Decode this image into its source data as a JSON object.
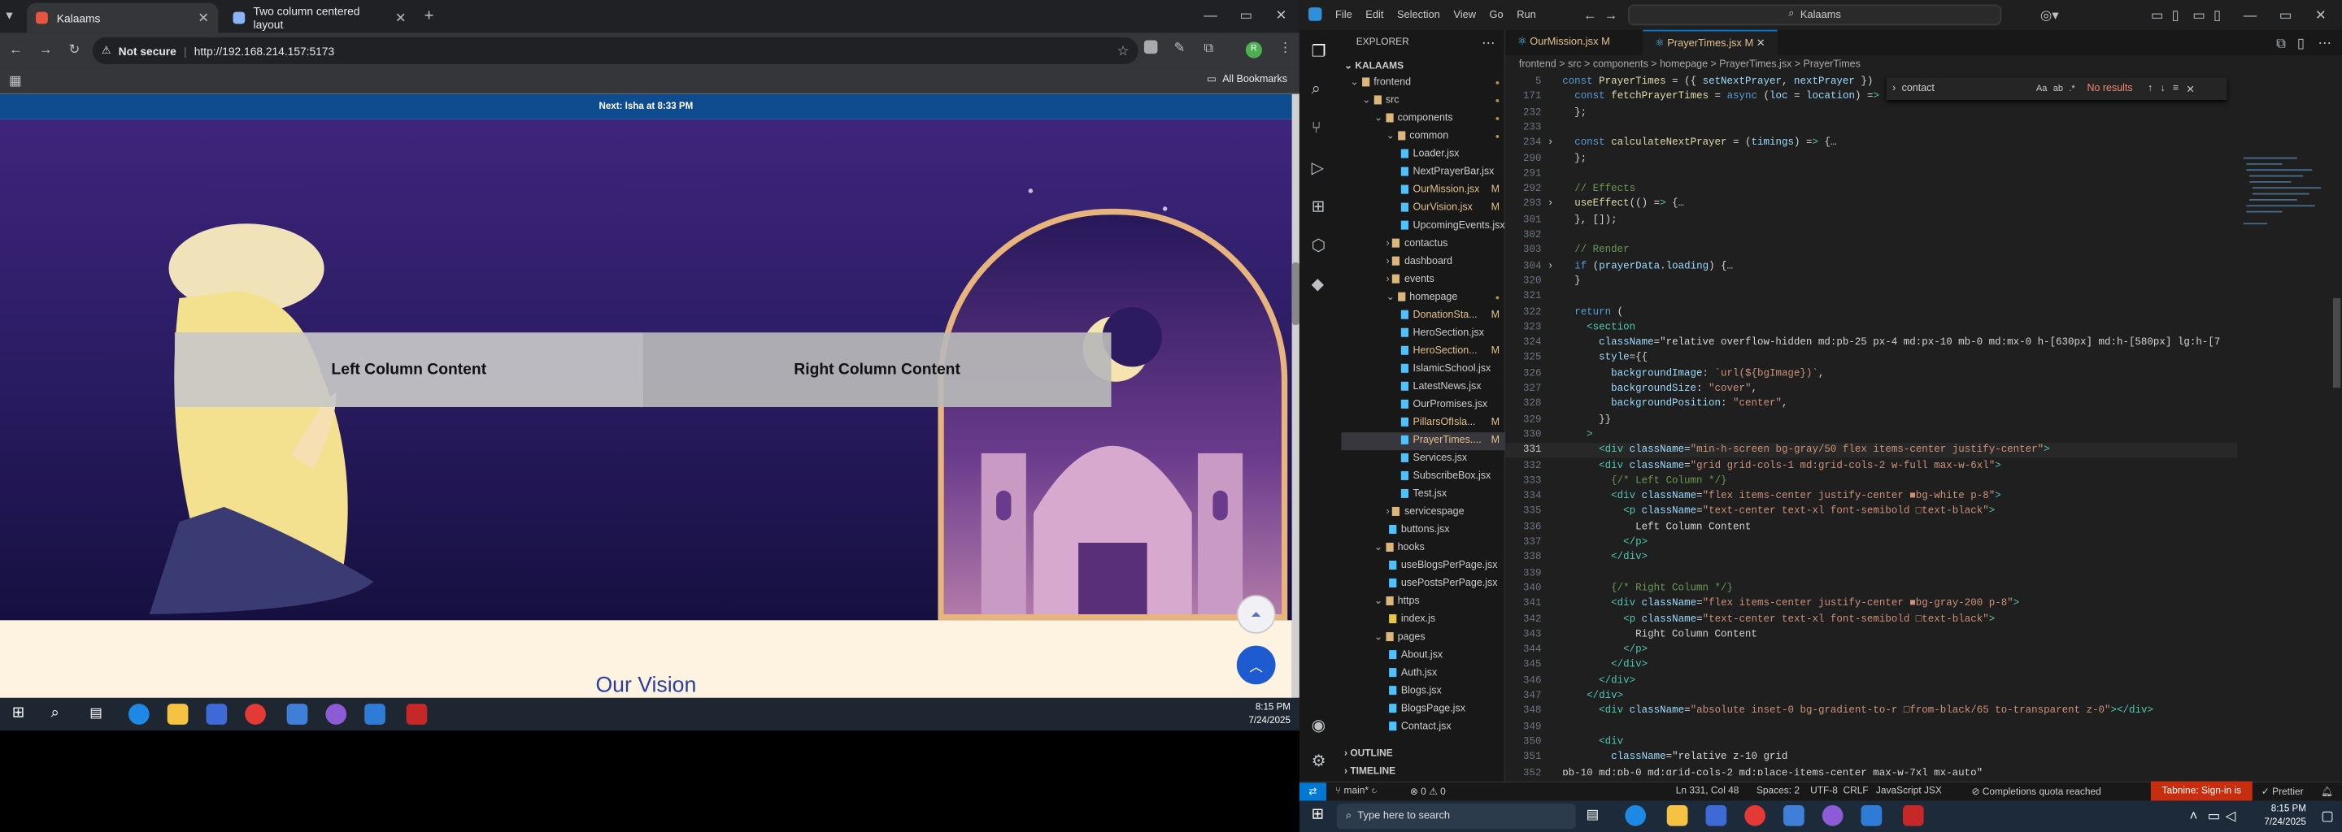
{
  "browser": {
    "tabs": [
      {
        "title": "Kalaams"
      },
      {
        "title": "Two column centered layout"
      }
    ],
    "security_label": "Not secure",
    "url": "http://192.168.214.157:5173",
    "all_bookmarks": "All Bookmarks"
  },
  "page": {
    "next_prayer": "Next: Isha at 8:33 PM",
    "left_column": "Left Column Content",
    "right_column": "Right Column Content",
    "section_title": "Our Vision"
  },
  "taskbar_left": {
    "time": "8:15 PM",
    "date": "7/24/2025"
  },
  "vscode": {
    "menu": [
      "File",
      "Edit",
      "Selection",
      "View",
      "Go",
      "Run"
    ],
    "search": "Kalaams",
    "explorer_title": "EXPLORER",
    "root": "KALAAMS",
    "tree": [
      {
        "name": "frontend",
        "type": "folder",
        "depth": 0,
        "status": "dot"
      },
      {
        "name": "src",
        "type": "folder",
        "depth": 1,
        "status": "dot"
      },
      {
        "name": "components",
        "type": "folder",
        "depth": 2,
        "status": "dot"
      },
      {
        "name": "common",
        "type": "folder",
        "depth": 3,
        "status": "dot"
      },
      {
        "name": "Loader.jsx",
        "type": "file",
        "depth": 4,
        "status": ""
      },
      {
        "name": "NextPrayerBar.jsx",
        "type": "file",
        "depth": 4,
        "status": ""
      },
      {
        "name": "OurMission.jsx",
        "type": "file",
        "depth": 4,
        "status": "M"
      },
      {
        "name": "OurVision.jsx",
        "type": "file",
        "depth": 4,
        "status": "M"
      },
      {
        "name": "UpcomingEvents.jsx",
        "type": "file",
        "depth": 4,
        "status": ""
      },
      {
        "name": "contactus",
        "type": "folderc",
        "depth": 3,
        "status": ""
      },
      {
        "name": "dashboard",
        "type": "folderc",
        "depth": 3,
        "status": ""
      },
      {
        "name": "events",
        "type": "folderc",
        "depth": 3,
        "status": ""
      },
      {
        "name": "homepage",
        "type": "folder",
        "depth": 3,
        "status": "dot"
      },
      {
        "name": "DonationSta...",
        "type": "file",
        "depth": 4,
        "status": "M"
      },
      {
        "name": "HeroSection.jsx",
        "type": "file",
        "depth": 4,
        "status": ""
      },
      {
        "name": "HeroSection...",
        "type": "file",
        "depth": 4,
        "status": "M"
      },
      {
        "name": "IslamicSchool.jsx",
        "type": "file",
        "depth": 4,
        "status": ""
      },
      {
        "name": "LatestNews.jsx",
        "type": "file",
        "depth": 4,
        "status": ""
      },
      {
        "name": "OurPromises.jsx",
        "type": "file",
        "depth": 4,
        "status": ""
      },
      {
        "name": "PillarsOfIsla...",
        "type": "file",
        "depth": 4,
        "status": "M"
      },
      {
        "name": "PrayerTimes....",
        "type": "file",
        "depth": 4,
        "status": "M"
      },
      {
        "name": "Services.jsx",
        "type": "file",
        "depth": 4,
        "status": ""
      },
      {
        "name": "SubscribeBox.jsx",
        "type": "file",
        "depth": 4,
        "status": ""
      },
      {
        "name": "Test.jsx",
        "type": "file",
        "depth": 4,
        "status": ""
      },
      {
        "name": "servicespage",
        "type": "folderc",
        "depth": 3,
        "status": ""
      },
      {
        "name": "buttons.jsx",
        "type": "file",
        "depth": 3,
        "status": ""
      },
      {
        "name": "hooks",
        "type": "folder",
        "depth": 2,
        "status": ""
      },
      {
        "name": "useBlogsPerPage.jsx",
        "type": "file",
        "depth": 3,
        "status": ""
      },
      {
        "name": "usePostsPerPage.jsx",
        "type": "file",
        "depth": 3,
        "status": ""
      },
      {
        "name": "https",
        "type": "folder",
        "depth": 2,
        "status": ""
      },
      {
        "name": "index.js",
        "type": "file",
        "depth": 3,
        "status": ""
      },
      {
        "name": "pages",
        "type": "folder",
        "depth": 2,
        "status": ""
      },
      {
        "name": "About.jsx",
        "type": "file",
        "depth": 3,
        "status": ""
      },
      {
        "name": "Auth.jsx",
        "type": "file",
        "depth": 3,
        "status": ""
      },
      {
        "name": "Blogs.jsx",
        "type": "file",
        "depth": 3,
        "status": ""
      },
      {
        "name": "BlogsPage.jsx",
        "type": "file",
        "depth": 3,
        "status": ""
      },
      {
        "name": "Contact.jsx",
        "type": "file",
        "depth": 3,
        "status": ""
      }
    ],
    "outline": "OUTLINE",
    "timeline": "TIMELINE",
    "editor_tabs": [
      {
        "name": "OurMission.jsx",
        "status": "M"
      },
      {
        "name": "PrayerTimes.jsx",
        "status": "M"
      }
    ],
    "breadcrumb": "frontend > src > components > homepage > PrayerTimes.jsx > PrayerTimes",
    "find": {
      "query": "contact",
      "result": "No results"
    },
    "code": [
      {
        "n": "5",
        "t": "const PrayerTimes = ({ setNextPrayer, nextPrayer })"
      },
      {
        "n": "171",
        "t": "  const fetchPrayerTimes = async (loc = location) =>"
      },
      {
        "n": "232",
        "t": "  };"
      },
      {
        "n": "233",
        "t": ""
      },
      {
        "n": "234",
        "t": "  const calculateNextPrayer = (timings) => {…"
      },
      {
        "n": "290",
        "t": "  };"
      },
      {
        "n": "291",
        "t": ""
      },
      {
        "n": "292",
        "t": "  // Effects"
      },
      {
        "n": "293",
        "t": "  useEffect(() => {…"
      },
      {
        "n": "301",
        "t": "  }, []);"
      },
      {
        "n": "302",
        "t": ""
      },
      {
        "n": "303",
        "t": "  // Render"
      },
      {
        "n": "304",
        "t": "  if (prayerData.loading) {…"
      },
      {
        "n": "320",
        "t": "  }"
      },
      {
        "n": "321",
        "t": ""
      },
      {
        "n": "322",
        "t": "  return ("
      },
      {
        "n": "323",
        "t": "    <section"
      },
      {
        "n": "324",
        "t": "      className=\"relative overflow-hidden md:pb-25 px-4 md:px-10 mb-0 md:mx-0 h-[630px] md:h-[580px] lg:h-[7"
      },
      {
        "n": "325",
        "t": "      style={{"
      },
      {
        "n": "326",
        "t": "        backgroundImage: `url(${bgImage})`,"
      },
      {
        "n": "327",
        "t": "        backgroundSize: \"cover\","
      },
      {
        "n": "328",
        "t": "        backgroundPosition: \"center\","
      },
      {
        "n": "329",
        "t": "      }}"
      },
      {
        "n": "330",
        "t": "    >"
      },
      {
        "n": "331",
        "t": "      <div className=\"min-h-screen bg-gray/50 flex items-center justify-center\">"
      },
      {
        "n": "332",
        "t": "      <div className=\"grid grid-cols-1 md:grid-cols-2 w-full max-w-6xl\">"
      },
      {
        "n": "333",
        "t": "        {/* Left Column */}"
      },
      {
        "n": "334",
        "t": "        <div className=\"flex items-center justify-center ■bg-white p-8\">"
      },
      {
        "n": "335",
        "t": "          <p className=\"text-center text-xl font-semibold □text-black\">"
      },
      {
        "n": "336",
        "t": "            Left Column Content"
      },
      {
        "n": "337",
        "t": "          </p>"
      },
      {
        "n": "338",
        "t": "        </div>"
      },
      {
        "n": "339",
        "t": ""
      },
      {
        "n": "340",
        "t": "        {/* Right Column */}"
      },
      {
        "n": "341",
        "t": "        <div className=\"flex items-center justify-center ■bg-gray-200 p-8\">"
      },
      {
        "n": "342",
        "t": "          <p className=\"text-center text-xl font-semibold □text-black\">"
      },
      {
        "n": "343",
        "t": "            Right Column Content"
      },
      {
        "n": "344",
        "t": "          </p>"
      },
      {
        "n": "345",
        "t": "        </div>"
      },
      {
        "n": "346",
        "t": "      </div>"
      },
      {
        "n": "347",
        "t": "    </div>"
      },
      {
        "n": "348",
        "t": "      <div className=\"absolute inset-0 bg-gradient-to-r □from-black/65 to-transparent z-0\"></div>"
      },
      {
        "n": "349",
        "t": ""
      },
      {
        "n": "350",
        "t": "      <div"
      },
      {
        "n": "351",
        "t": "        className=\"relative z-10 grid"
      },
      {
        "n": "352",
        "t": "pb-10 md:pb-0 md:grid-cols-2 md:place-items-center max-w-7xl mx-auto\""
      }
    ],
    "status": {
      "branch": "main*",
      "problems": "⊗ 0 ⚠ 0",
      "position": "Ln 331, Col 48",
      "spaces": "Spaces: 2",
      "encoding": "UTF-8",
      "eol": "CRLF",
      "language": "JavaScript JSX",
      "quota": "Completions quota reached",
      "tabnine": "Tabnine: Sign-in is required",
      "prettier": "Prettier"
    }
  },
  "taskbar_right": {
    "search_placeholder": "Type here to search",
    "time": "8:15 PM",
    "date": "7/24/2025"
  }
}
